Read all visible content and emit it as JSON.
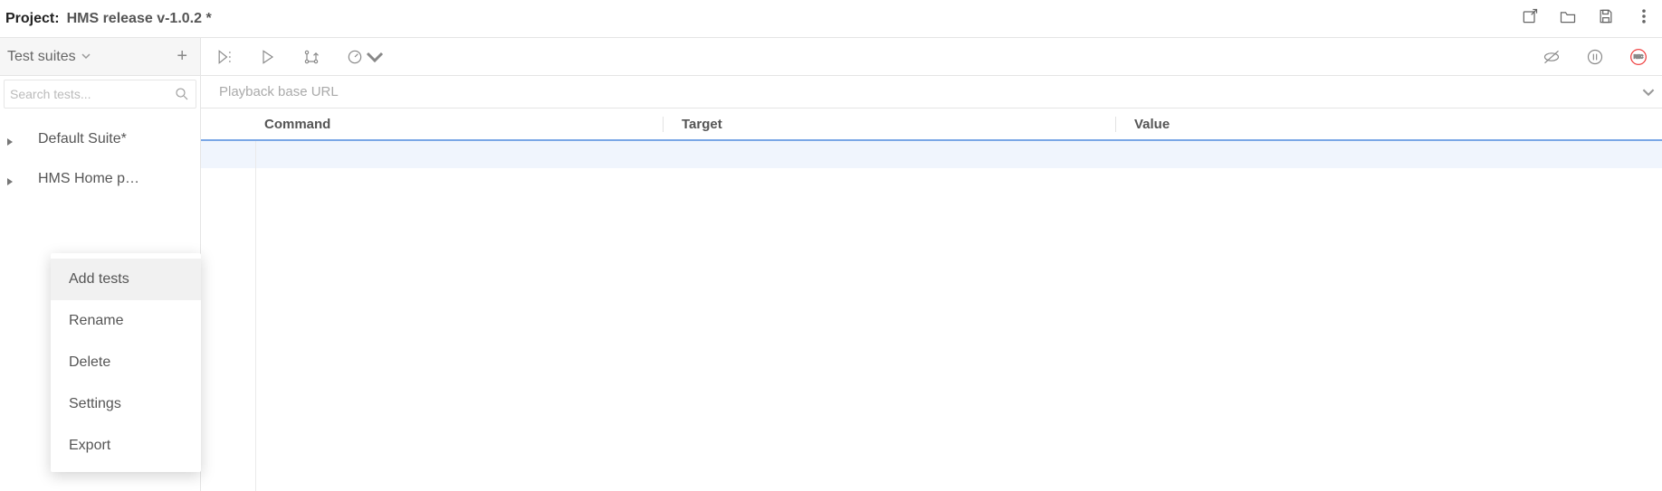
{
  "project": {
    "label": "Project:",
    "name": "HMS release v-1.0.2 *"
  },
  "sidebar": {
    "heading": "Test suites",
    "search_placeholder": "Search tests...",
    "suites": [
      {
        "name": "Default Suite*"
      },
      {
        "name": "HMS Home p…"
      }
    ]
  },
  "context_menu": {
    "items": [
      {
        "label": "Add tests",
        "hover": true
      },
      {
        "label": "Rename"
      },
      {
        "label": "Delete"
      },
      {
        "label": "Settings"
      },
      {
        "label": "Export"
      }
    ]
  },
  "url_bar": {
    "placeholder": "Playback base URL"
  },
  "table": {
    "headers": {
      "command": "Command",
      "target": "Target",
      "value": "Value"
    }
  }
}
